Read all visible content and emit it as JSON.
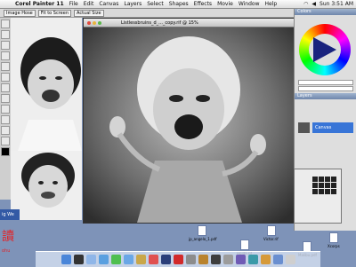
{
  "menubar": {
    "app_name": "Corel Painter 11",
    "items": [
      "File",
      "Edit",
      "Canvas",
      "Layers",
      "Select",
      "Shapes",
      "Effects",
      "Movie",
      "Window",
      "Help"
    ],
    "clock": "Sun 3:51 AM"
  },
  "property_bar": {
    "items": [
      "Image Hose",
      "Fit to Screen",
      "Actual Size"
    ]
  },
  "document": {
    "title": "Listlessbruins_d_..._copy.rif @ 15%"
  },
  "panels": {
    "colors_title": "Colors",
    "layers_title": "Layers",
    "layer_name": "Canvas"
  },
  "sidebar": {
    "label": "ig We"
  },
  "desktop": {
    "icons": [
      {
        "label": "jp_angelo_1.pdf"
      },
      {
        "label": "Victor.rif"
      },
      {
        "label": "Xcorps"
      },
      {
        "label": "Holda.rif"
      },
      {
        "label": "Malibu.pdf"
      }
    ],
    "kanji": "讀",
    "kanji_sub": "ohu"
  },
  "colors": {
    "accent_blue": "#3875d7",
    "desktop": "#7e93b8"
  }
}
